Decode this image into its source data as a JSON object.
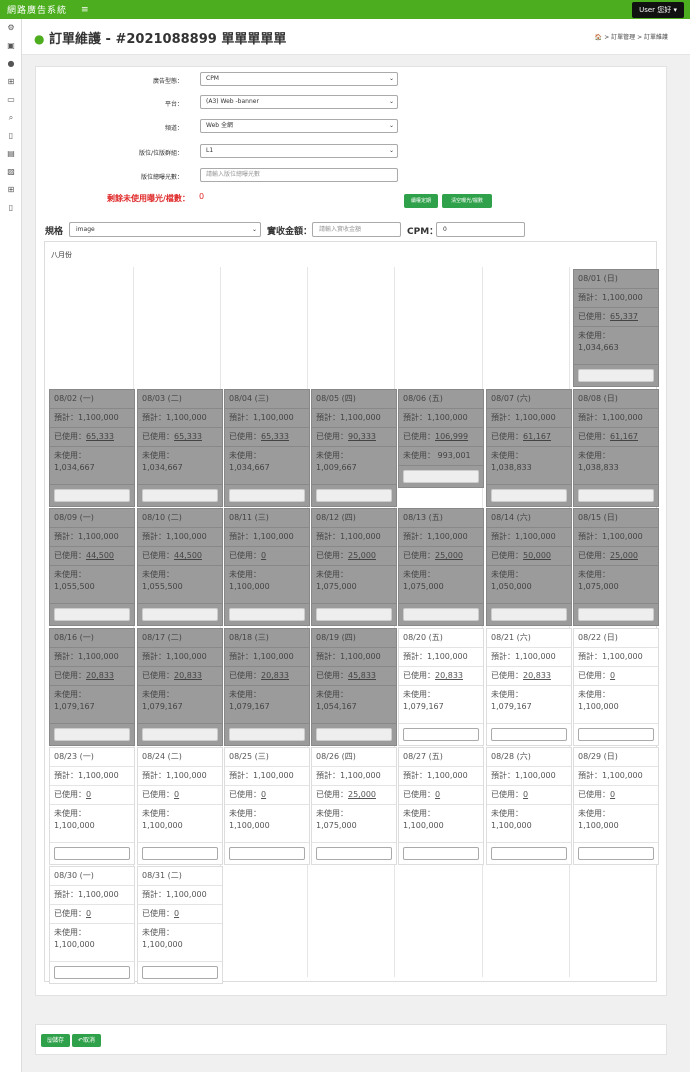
{
  "app": {
    "title": "網路廣告系統",
    "menu_icon": "≡",
    "user_label": "User 您好 ▾"
  },
  "header": {
    "title": "訂單維護 - #2021088899 單單單單單",
    "breadcrumb": "🏠 > 訂單管理 > 訂單維護"
  },
  "sidebar": {
    "icons": [
      "gear-icon",
      "film-icon",
      "user-icon",
      "sitemap-icon",
      "inbox-icon",
      "search-icon",
      "file-icon",
      "list-icon",
      "image-icon",
      "sitemap2-icon",
      "document-icon"
    ]
  },
  "form": {
    "ad_type": {
      "label": "廣告型態：",
      "value": "CPM"
    },
    "platform": {
      "label": "平台：",
      "value": "(A3) Web -banner"
    },
    "channel": {
      "label": "頻道：",
      "value": "Web 全網"
    },
    "position": {
      "label": "版位/位版群組：",
      "value": "L1"
    },
    "impressions": {
      "label": "版位總曝光數：",
      "placeholder": "請輸入版位總曝光數"
    },
    "remaining": {
      "label": "剩餘未使用曝光/檔數：",
      "value": "0"
    },
    "buttons": {
      "average": "續權定期",
      "clear": "清空曝光/檔數"
    }
  },
  "spec": {
    "label": "規格",
    "value": "image",
    "amount_label": "實收金額：",
    "amount_placeholder": "請輸入實收金額",
    "cpm_label": "CPM：",
    "cpm_value": "0"
  },
  "calendar": {
    "month": "八月份",
    "first_weekday": 6,
    "days": [
      {
        "date": "08/01 (日)",
        "plan": "預計：1,100,000",
        "used_label": "已使用：",
        "used": "65,337",
        "unused": "1,034,663",
        "state": "gray"
      },
      {
        "date": "08/02 (一)",
        "plan": "預計：1,100,000",
        "used_label": "已使用：",
        "used": "65,333",
        "unused": "1,034,667",
        "state": "gray"
      },
      {
        "date": "08/03 (二)",
        "plan": "預計：1,100,000",
        "used_label": "已使用：",
        "used": "65,333",
        "unused": "1,034,667",
        "state": "gray"
      },
      {
        "date": "08/04 (三)",
        "plan": "預計：1,100,000",
        "used_label": "已使用：",
        "used": "65,333",
        "unused": "1,034,667",
        "state": "gray"
      },
      {
        "date": "08/05 (四)",
        "plan": "預計：1,100,000",
        "used_label": "已使用：",
        "used": "90,333",
        "unused": "1,009,667",
        "state": "gray"
      },
      {
        "date": "08/06 (五)",
        "plan": "預計：1,100,000",
        "used_label": "已使用：",
        "used": "106,999",
        "unused": "993,001",
        "state": "gray",
        "inline": true
      },
      {
        "date": "08/07 (六)",
        "plan": "預計：1,100,000",
        "used_label": "已使用：",
        "used": "61,167",
        "unused": "1,038,833",
        "state": "gray"
      },
      {
        "date": "08/08 (日)",
        "plan": "預計：1,100,000",
        "used_label": "已使用：",
        "used": "61,167",
        "unused": "1,038,833",
        "state": "gray"
      },
      {
        "date": "08/09 (一)",
        "plan": "預計：1,100,000",
        "used_label": "已使用：",
        "used": "44,500",
        "unused": "1,055,500",
        "state": "gray"
      },
      {
        "date": "08/10 (二)",
        "plan": "預計：1,100,000",
        "used_label": "已使用：",
        "used": "44,500",
        "unused": "1,055,500",
        "state": "gray"
      },
      {
        "date": "08/11 (三)",
        "plan": "預計：1,100,000",
        "used_label": "已使用：",
        "used": "0",
        "unused": "1,100,000",
        "state": "gray"
      },
      {
        "date": "08/12 (四)",
        "plan": "預計：1,100,000",
        "used_label": "已使用：",
        "used": "25,000",
        "unused": "1,075,000",
        "state": "gray"
      },
      {
        "date": "08/13 (五)",
        "plan": "預計：1,100,000",
        "used_label": "已使用：",
        "used": "25,000",
        "unused": "1,075,000",
        "state": "gray"
      },
      {
        "date": "08/14 (六)",
        "plan": "預計：1,100,000",
        "used_label": "已使用：",
        "used": "50,000",
        "unused": "1,050,000",
        "state": "gray"
      },
      {
        "date": "08/15 (日)",
        "plan": "預計：1,100,000",
        "used_label": "已使用：",
        "used": "25,000",
        "unused": "1,075,000",
        "state": "gray"
      },
      {
        "date": "08/16 (一)",
        "plan": "預計：1,100,000",
        "used_label": "已使用：",
        "used": "20,833",
        "unused": "1,079,167",
        "state": "gray"
      },
      {
        "date": "08/17 (二)",
        "plan": "預計：1,100,000",
        "used_label": "已使用：",
        "used": "20,833",
        "unused": "1,079,167",
        "state": "gray"
      },
      {
        "date": "08/18 (三)",
        "plan": "預計：1,100,000",
        "used_label": "已使用：",
        "used": "20,833",
        "unused": "1,079,167",
        "state": "gray"
      },
      {
        "date": "08/19 (四)",
        "plan": "預計：1,100,000",
        "used_label": "已使用：",
        "used": "45,833",
        "unused": "1,054,167",
        "state": "gray"
      },
      {
        "date": "08/20 (五)",
        "plan": "預計：1,100,000",
        "used_label": "已使用：",
        "used": "20,833",
        "unused": "1,079,167",
        "state": "white"
      },
      {
        "date": "08/21 (六)",
        "plan": "預計：1,100,000",
        "used_label": "已使用：",
        "used": "20,833",
        "unused": "1,079,167",
        "state": "white"
      },
      {
        "date": "08/22 (日)",
        "plan": "預計：1,100,000",
        "used_label": "已使用：",
        "used": "0",
        "unused": "1,100,000",
        "state": "white"
      },
      {
        "date": "08/23 (一)",
        "plan": "預計：1,100,000",
        "used_label": "已使用：",
        "used": "0",
        "unused": "1,100,000",
        "state": "white"
      },
      {
        "date": "08/24 (二)",
        "plan": "預計：1,100,000",
        "used_label": "已使用：",
        "used": "0",
        "unused": "1,100,000",
        "state": "white"
      },
      {
        "date": "08/25 (三)",
        "plan": "預計：1,100,000",
        "used_label": "已使用：",
        "used": "0",
        "unused": "1,100,000",
        "state": "white"
      },
      {
        "date": "08/26 (四)",
        "plan": "預計：1,100,000",
        "used_label": "已使用：",
        "used": "25,000",
        "unused": "1,075,000",
        "state": "white"
      },
      {
        "date": "08/27 (五)",
        "plan": "預計：1,100,000",
        "used_label": "已使用：",
        "used": "0",
        "unused": "1,100,000",
        "state": "white"
      },
      {
        "date": "08/28 (六)",
        "plan": "預計：1,100,000",
        "used_label": "已使用：",
        "used": "0",
        "unused": "1,100,000",
        "state": "white"
      },
      {
        "date": "08/29 (日)",
        "plan": "預計：1,100,000",
        "used_label": "已使用：",
        "used": "0",
        "unused": "1,100,000",
        "state": "white"
      },
      {
        "date": "08/30 (一)",
        "plan": "預計：1,100,000",
        "used_label": "已使用：",
        "used": "0",
        "unused": "1,100,000",
        "state": "white"
      },
      {
        "date": "08/31 (二)",
        "plan": "預計：1,100,000",
        "used_label": "已使用：",
        "used": "0",
        "unused": "1,100,000",
        "state": "white"
      }
    ],
    "unused_label": "未使用："
  },
  "footer": {
    "save": "🖫儲存",
    "cancel": "↶取消"
  },
  "colors": {
    "brand": "#4cae1e",
    "button": "#2fa14a",
    "warning": "#e02b2b",
    "past_day": "#9b9b9b"
  }
}
